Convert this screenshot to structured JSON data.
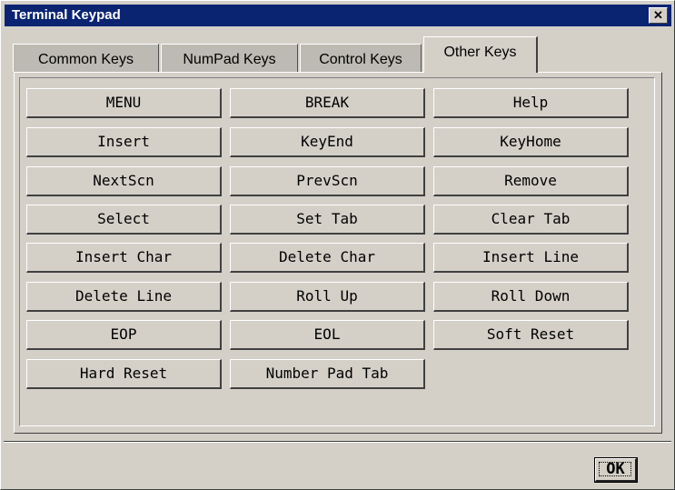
{
  "window": {
    "title": "Terminal Keypad",
    "close_label": "✕"
  },
  "tabs": [
    {
      "label": "Common Keys",
      "active": false
    },
    {
      "label": "NumPad Keys",
      "active": false
    },
    {
      "label": "Control Keys",
      "active": false
    },
    {
      "label": "Other Keys",
      "active": true
    }
  ],
  "keys": [
    "MENU",
    "BREAK",
    "Help",
    "Insert",
    "KeyEnd",
    "KeyHome",
    "NextScn",
    "PrevScn",
    "Remove",
    "Select",
    "Set Tab",
    "Clear Tab",
    "Insert Char",
    "Delete Char",
    "Insert Line",
    "Delete Line",
    "Roll Up",
    "Roll Down",
    "EOP",
    "EOL",
    "Soft Reset",
    "Hard Reset",
    "Number Pad Tab"
  ],
  "footer": {
    "ok_label": "OK"
  },
  "colors": {
    "titlebar": "#0a2472",
    "face": "#d4d0c8",
    "inactive_tab": "#bdbab3"
  }
}
